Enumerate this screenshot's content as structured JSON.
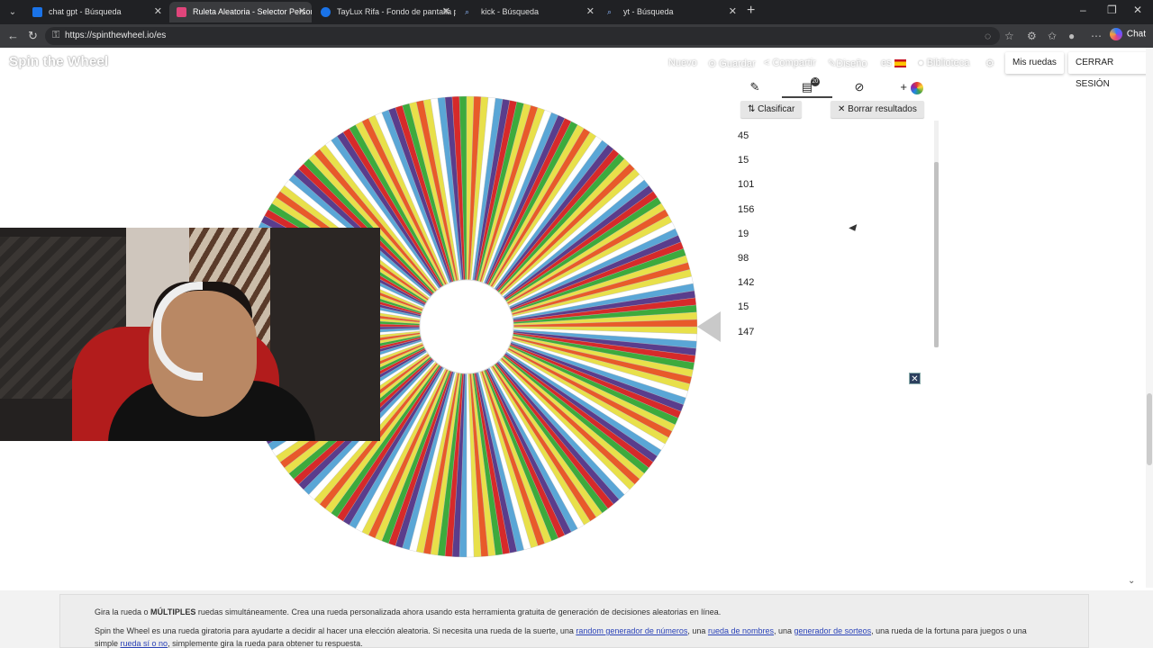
{
  "browser": {
    "tabs": [
      {
        "title": "chat gpt - Búsqueda",
        "active": false,
        "favicon_color": "#1a73e8"
      },
      {
        "title": "Ruleta Aleatoria - Selector Person...",
        "active": true,
        "favicon_color": "#e0457b"
      },
      {
        "title": "TayLux Rifa - Fondo de pantalla p...",
        "active": false,
        "favicon_color": "#1a73e8"
      },
      {
        "title": "kick - Búsqueda",
        "active": false,
        "favicon_color": "#1a73e8"
      },
      {
        "title": "yt - Búsqueda",
        "active": false,
        "favicon_color": "#1a73e8"
      }
    ],
    "url": "https://spinthewheel.io/es",
    "chat_label": "Chat"
  },
  "header": {
    "logo": "Spin the Wheel",
    "links": {
      "nuevo": "Nuevo",
      "guardar": "Guardar",
      "compartir": "Compartir",
      "diseno": "Diseño",
      "language": "es",
      "biblioteca": "Biblioteca"
    },
    "mis_ruedas": "Mis ruedas",
    "cerrar_sesion": "CERRAR SESIÓN"
  },
  "panel": {
    "results_badge": "20",
    "sort_label": "Clasificar",
    "clear_label": "Borrar resultados",
    "results": [
      "45",
      "15",
      "101",
      "156",
      "19",
      "98",
      "142",
      "15",
      "147"
    ]
  },
  "wheel": {
    "segment_count": 200,
    "colors": [
      "#e8e04a",
      "#ffffff",
      "#5aa6d6",
      "#5a3d8c",
      "#d62a2a",
      "#3daa3d",
      "#e8e04a",
      "#e85a2a"
    ]
  },
  "footer": {
    "line1_pre": "Gira la rueda o ",
    "line1_bold": "MÚLTIPLES",
    "line1_post": " ruedas simultáneamente. Crea una rueda personalizada ahora usando esta herramienta gratuita de generación de decisiones aleatorias en línea.",
    "line2_pre": "Spin the Wheel es una rueda giratoria para ayudarte a decidir al hacer una elección aleatoria. Si necesita una rueda de la suerte, una ",
    "link1": "random generador de números",
    "line2_mid1": ", una ",
    "link2": "rueda de nombres",
    "line2_mid2": ", una ",
    "link3": "generador de sorteos",
    "line2_post": ", una rueda de la fortuna para juegos o una",
    "line3_pre": "simple ",
    "link4": "rueda sí o no",
    "line3_post": ", simplemente gira la rueda para obtener tu respuesta."
  }
}
